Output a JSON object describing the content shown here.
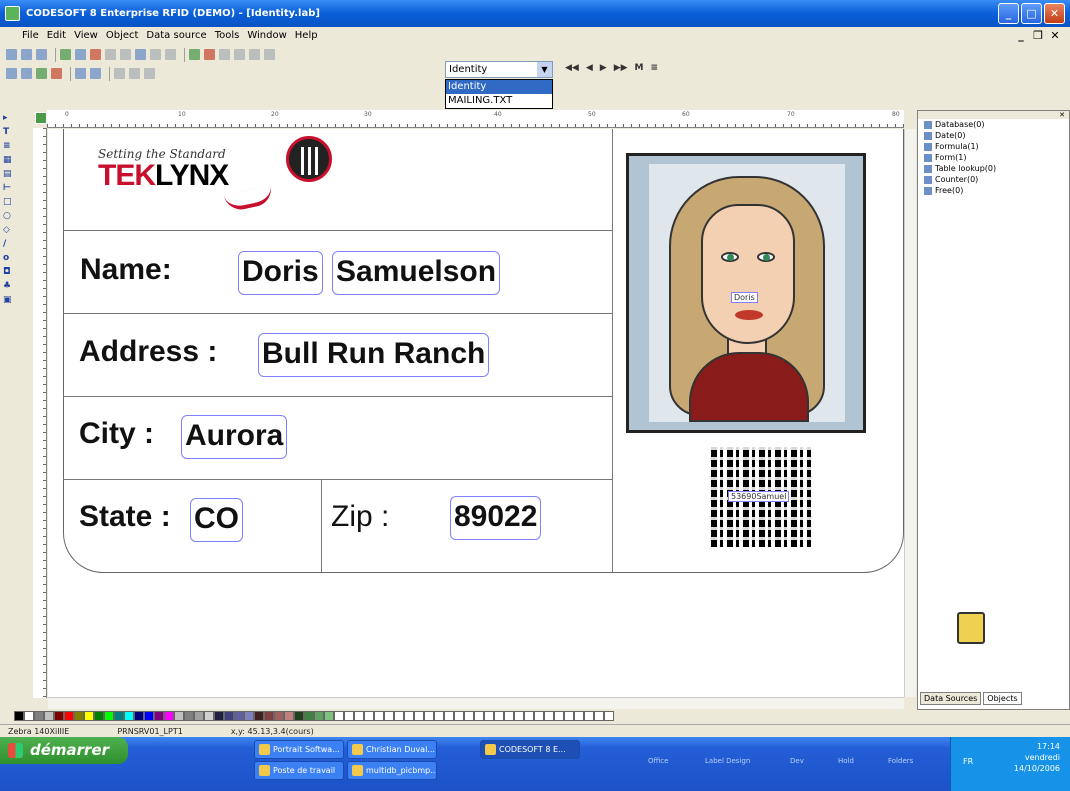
{
  "window": {
    "title": "CODESOFT 8 Enterprise RFID (DEMO) - [Identity.lab]"
  },
  "menu": [
    "File",
    "Edit",
    "View",
    "Object",
    "Data source",
    "Tools",
    "Window",
    "Help"
  ],
  "datasource": {
    "selected": "Identity",
    "options": [
      "Identity",
      "MAILING.TXT"
    ]
  },
  "nav_buttons": [
    "◀◀",
    "◀",
    "▶",
    "▶▶",
    "M",
    "≡"
  ],
  "ruler_marks": [
    "0",
    "10",
    "20",
    "30",
    "40",
    "50",
    "60",
    "70",
    "80"
  ],
  "label": {
    "logo_tagline": "Setting the Standard",
    "logo_name_red": "TEK",
    "logo_name_black": "LYNX",
    "name_label": "Name:",
    "first_name": "Doris",
    "last_name": "Samuelson",
    "address_label": "Address :",
    "address_value": "Bull Run Ranch",
    "city_label": "City :",
    "city_value": "Aurora",
    "state_label": "State :",
    "state_value": "CO",
    "zip_label": "Zip :",
    "zip_value": "89022",
    "photo_tag": "Doris",
    "barcode_tag": "53690Samuel"
  },
  "data_sources_panel": {
    "items": [
      "Database(0)",
      "Date(0)",
      "Formula(1)",
      "Form(1)",
      "Table lookup(0)",
      "Counter(0)",
      "Free(0)"
    ],
    "tabs": [
      "Data Sources",
      "Objects"
    ]
  },
  "statusbar": {
    "printer": "Zebra 140XiIIIE",
    "port": "PRNSRV01_LPT1",
    "coords": "x,y: 45.13,3.4(cours)"
  },
  "taskbar": {
    "start_label": "démarrer",
    "tasks": [
      "Portrait Softwa...",
      "Christian Duval...",
      "CODESOFT 8 E...",
      "Poste de travail",
      "multidb_picbmp..."
    ],
    "quicklaunch": [
      "Office",
      "Label Design",
      "Dev",
      "Hold",
      "Folders"
    ],
    "lang": "FR",
    "time": "17:14",
    "day": "vendredi",
    "date": "14/10/2006"
  },
  "colors": {
    "accent_red": "#c8102e",
    "titlebar_blue": "#0a5fd8",
    "field_border": "#8080ff",
    "shirt": "#8a1b1b"
  }
}
